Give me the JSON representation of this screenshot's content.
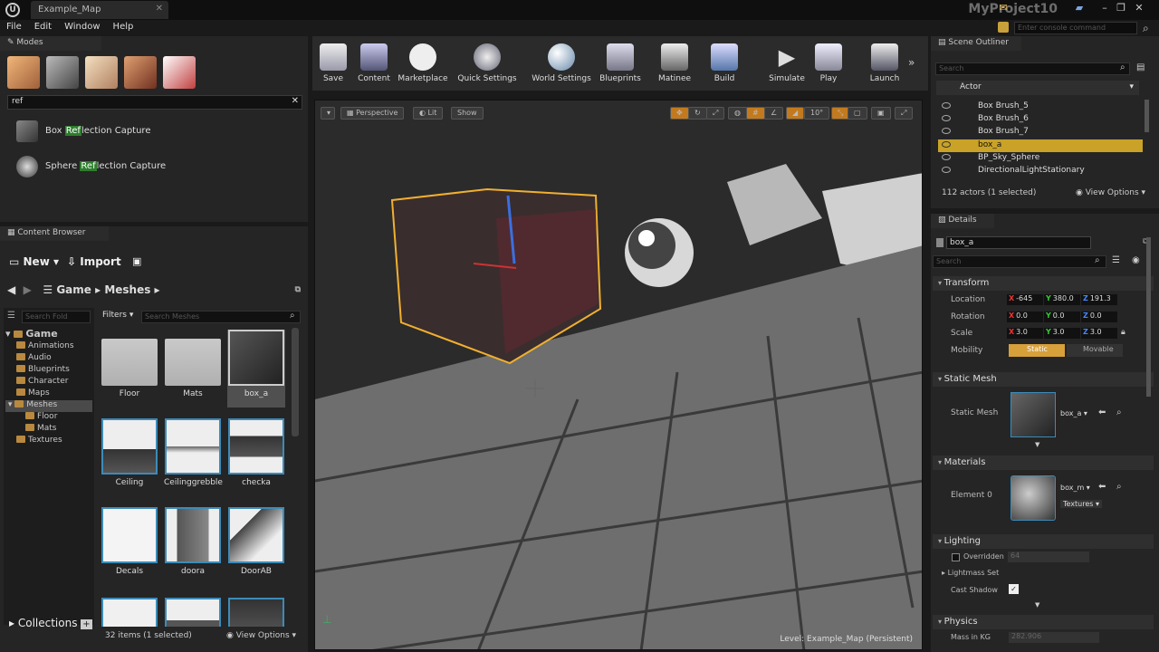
{
  "window": {
    "map_tab": "Example_Map",
    "project": "MyProject10",
    "console_placeholder": "Enter console command"
  },
  "menu": [
    "File",
    "Edit",
    "Window",
    "Help"
  ],
  "modes": {
    "title": "Modes",
    "search_value": "ref",
    "results": [
      {
        "pre": "Box ",
        "match": "Ref",
        "post": "lection Capture"
      },
      {
        "pre": "Sphere ",
        "match": "Ref",
        "post": "lection Capture"
      }
    ]
  },
  "content_browser": {
    "title": "Content Browser",
    "new_label": "New",
    "import_label": "Import",
    "breadcrumb": [
      "Game",
      "Meshes"
    ],
    "folder_search_placeholder": "Search Fold",
    "filters_label": "Filters",
    "mesh_search_placeholder": "Search Meshes",
    "tree": [
      "Game",
      "Animations",
      "Audio",
      "Blueprints",
      "Character",
      "Maps",
      "Meshes",
      "Floor",
      "Mats",
      "Textures"
    ],
    "assets": [
      "Floor",
      "Mats",
      "box_a",
      "Ceiling",
      "Ceilinggrebble",
      "checka",
      "Decals",
      "doora",
      "DoorAB"
    ],
    "collections_label": "Collections",
    "status": "32 items (1 selected)",
    "view_options": "View Options"
  },
  "toolbar": [
    "Save",
    "Content",
    "Marketplace",
    "Quick Settings",
    "World Settings",
    "Blueprints",
    "Matinee",
    "Build",
    "Simulate",
    "Play",
    "Launch"
  ],
  "viewport": {
    "perspective": "Perspective",
    "lit": "Lit",
    "show": "Show",
    "fov": "10°",
    "level": "Level:  Example_Map (Persistent)"
  },
  "outliner": {
    "title": "Scene Outliner",
    "search_placeholder": "Search",
    "column": "Actor",
    "rows": [
      "Box Brush_5",
      "Box Brush_6",
      "Box Brush_7",
      "box_a",
      "BP_Sky_Sphere",
      "DirectionalLightStationary"
    ],
    "status": "112 actors (1 selected)",
    "view_options": "View Options"
  },
  "details": {
    "title": "Details",
    "name": "box_a",
    "search_placeholder": "Search",
    "transform": "Transform",
    "location_label": "Location",
    "location": [
      "-645",
      "380.0",
      "191.3"
    ],
    "rotation_label": "Rotation",
    "rotation": [
      "0.0",
      "0.0",
      "0.0"
    ],
    "scale_label": "Scale",
    "scale": [
      "3.0",
      "3.0",
      "3.0"
    ],
    "mobility_label": "Mobility",
    "static": "Static",
    "movable": "Movable",
    "static_mesh": "Static Mesh",
    "mesh_field_label": "Static Mesh",
    "mesh_value": "box_a",
    "materials": "Materials",
    "element_label": "Element 0",
    "material_value": "box_m",
    "textures": "Textures",
    "lighting": "Lighting",
    "overridden": "Overridden",
    "overridden_value": "64",
    "lightmass": "Lightmass Set",
    "cast_shadow": "Cast Shadow",
    "physics": "Physics",
    "mass_label": "Mass in KG",
    "mass_value": "282.906"
  }
}
